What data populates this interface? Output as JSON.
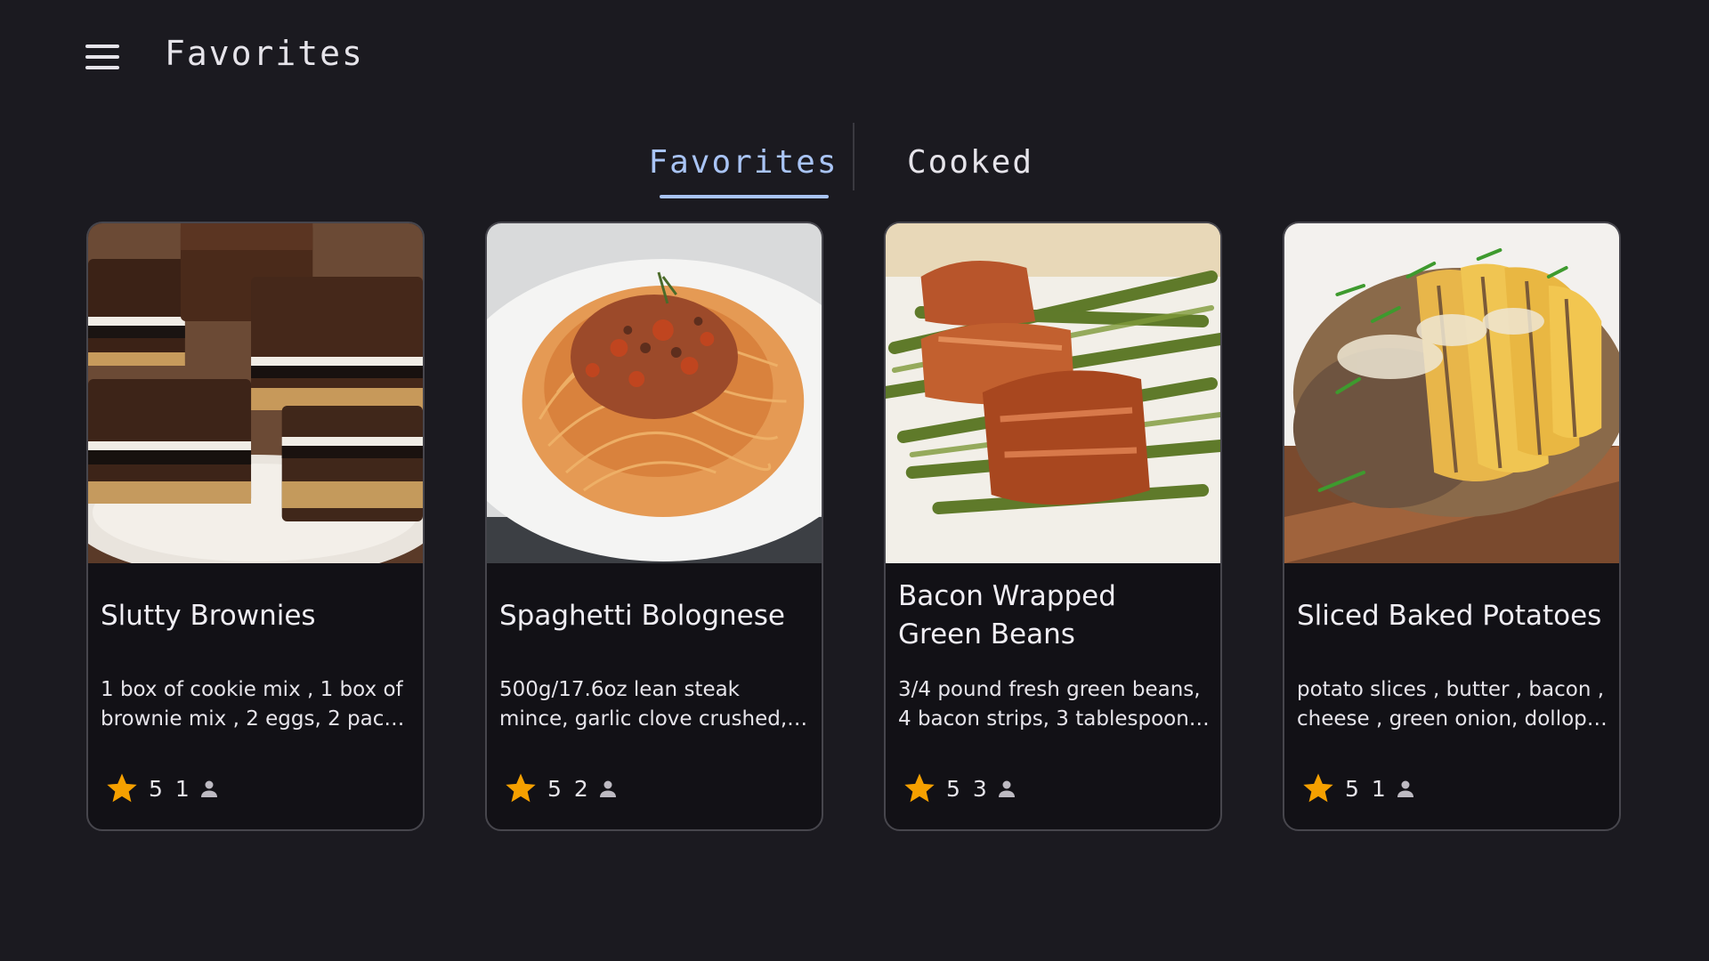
{
  "header": {
    "title": "Favorites",
    "menu_icon": "hamburger-menu-icon"
  },
  "tabs": [
    {
      "label": "Favorites",
      "selected": true
    },
    {
      "label": "Cooked",
      "selected": false
    }
  ],
  "colors": {
    "background": "#1b1a20",
    "card_background": "#121116",
    "card_border": "#47464d",
    "accent": "#a9c4f5",
    "star": "#f5a000"
  },
  "recipes": [
    {
      "title": "Slutty Brownies",
      "description": "1 box of cookie mix , 1 box of brownie mix , 2 eggs, 2 packs …",
      "rating": "5",
      "cooked_count": "1",
      "image": "brownies-photo"
    },
    {
      "title": "Spaghetti Bolognese",
      "description": "500g/17.6oz lean steak mince, garlic clove crushed, 2 beef ox…",
      "rating": "5",
      "cooked_count": "2",
      "image": "spaghetti-photo"
    },
    {
      "title": "Bacon Wrapped Green Beans",
      "description": "3/4 pound fresh green beans, 4 bacon strips, 3 tablespoons …",
      "rating": "5",
      "cooked_count": "3",
      "image": "green-beans-photo"
    },
    {
      "title": "Sliced Baked Potatoes",
      "description": "potato slices , butter , bacon , cheese , green  onion, dollop …",
      "rating": "5",
      "cooked_count": "1",
      "image": "baked-potato-photo"
    }
  ]
}
